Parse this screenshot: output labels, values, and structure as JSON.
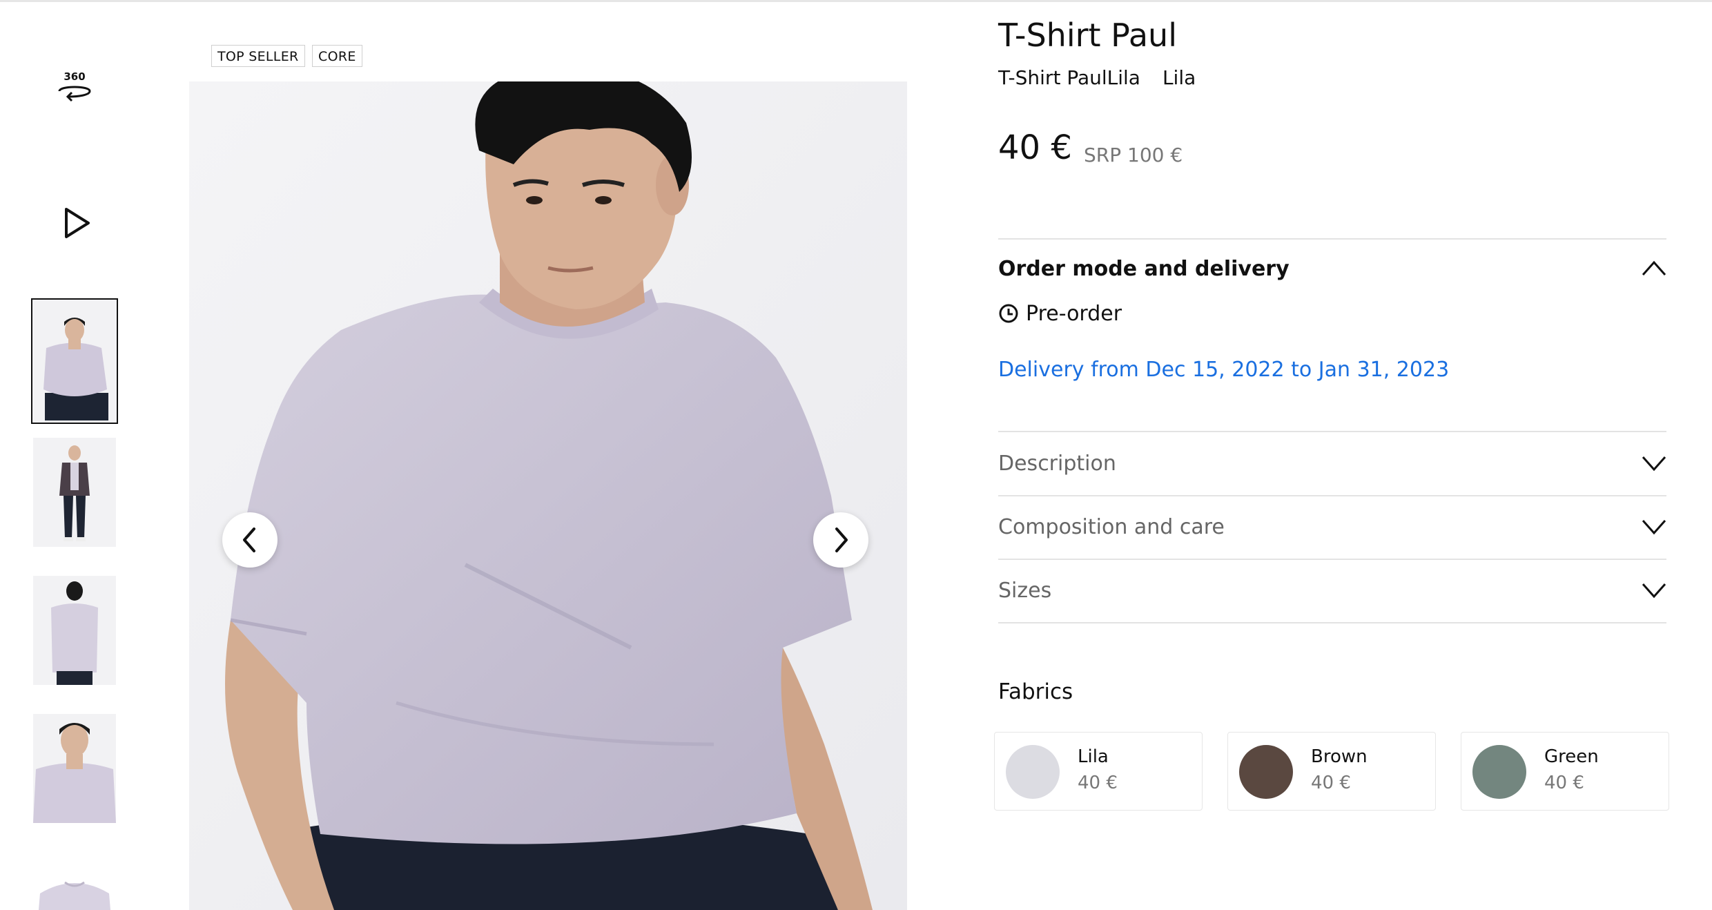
{
  "rail": {
    "label_360": "360",
    "thumbnails": [
      {
        "alt": "front-seated"
      },
      {
        "alt": "full-body-jacket"
      },
      {
        "alt": "back-view"
      },
      {
        "alt": "closeup"
      },
      {
        "alt": "flat-lay"
      }
    ]
  },
  "badges": [
    "TOP SELLER",
    "CORE"
  ],
  "product": {
    "title": "T-Shirt Paul",
    "subtitle_name": "T-Shirt PaulLila",
    "subtitle_color": "Lila",
    "price": "40 €",
    "srp": "SRP 100 €"
  },
  "order_section": {
    "title": "Order mode and delivery",
    "mode": "Pre-order",
    "delivery": "Delivery from Dec 15, 2022 to Jan 31, 2023"
  },
  "accordions": [
    {
      "label": "Description"
    },
    {
      "label": "Composition and care"
    },
    {
      "label": "Sizes"
    }
  ],
  "fabrics": {
    "label": "Fabrics",
    "options": [
      {
        "name": "Lila",
        "price": "40 €",
        "color": "#dcdce2"
      },
      {
        "name": "Brown",
        "price": "40 €",
        "color": "#5a4840"
      },
      {
        "name": "Green",
        "price": "40 €",
        "color": "#73867f"
      }
    ]
  },
  "colors": {
    "link_blue": "#1a6fe0",
    "shirt_lila": "#c8c3d3"
  }
}
